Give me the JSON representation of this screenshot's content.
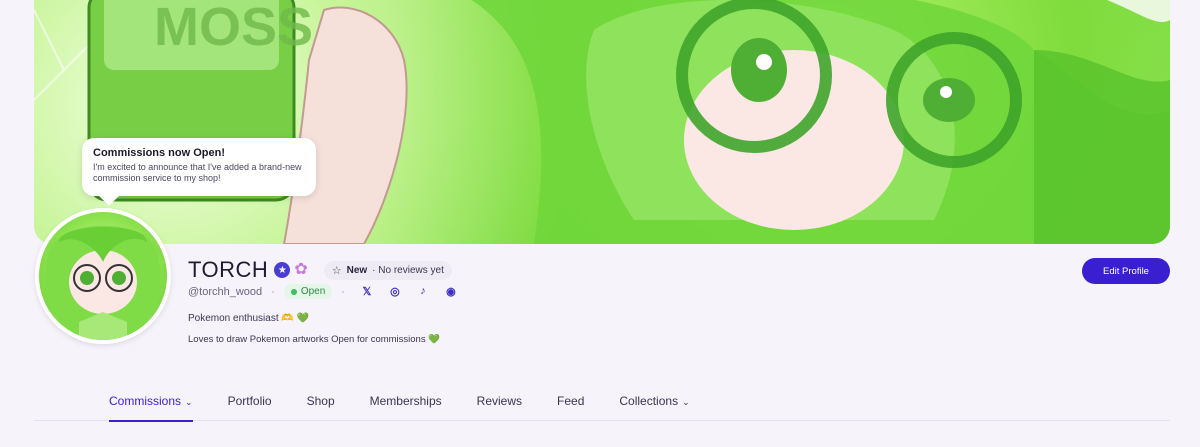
{
  "banner": {
    "sign_text": "MOSS",
    "announcement": {
      "title": "Commissions now Open!",
      "text": "I'm excited to announce that I've added a brand-new commission service to my shop!"
    }
  },
  "profile": {
    "name": "TORCH",
    "verified_icon": "star-badge-icon",
    "flower_icon": "flower-badge-icon",
    "rating_new": "New",
    "rating_text": "· No reviews yet",
    "handle": "@torchh_wood",
    "status": "Open",
    "bio_line1": "Pokemon enthusiast 🫶 💚",
    "bio_line2": "Loves to draw Pokemon artworks Open for commissions 💚",
    "edit_label": "Edit Profile",
    "socials": [
      {
        "name": "x-icon",
        "glyph": "𝕏"
      },
      {
        "name": "instagram-icon",
        "glyph": "◎"
      },
      {
        "name": "tiktok-icon",
        "glyph": "♪"
      },
      {
        "name": "discord-icon",
        "glyph": "◉"
      }
    ]
  },
  "tabs": [
    {
      "label": "Commissions",
      "active": true,
      "dropdown": true
    },
    {
      "label": "Portfolio"
    },
    {
      "label": "Shop"
    },
    {
      "label": "Memberships"
    },
    {
      "label": "Reviews"
    },
    {
      "label": "Feed"
    },
    {
      "label": "Collections",
      "dropdown": true
    }
  ],
  "colors": {
    "accent": "#3a1fd1",
    "open": "#3cbf5f",
    "banner": "#7fdc3c"
  }
}
